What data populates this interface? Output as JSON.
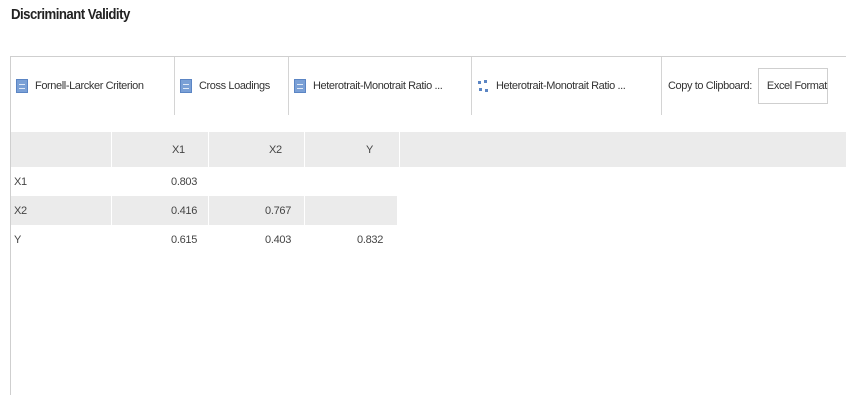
{
  "page": {
    "title": "Discriminant Validity"
  },
  "tabs": [
    {
      "label": "Fornell-Larcker Criterion",
      "icon": "table-icon"
    },
    {
      "label": "Cross Loadings",
      "icon": "table-icon"
    },
    {
      "label": "Heterotrait-Monotrait Ratio ...",
      "icon": "table-icon"
    },
    {
      "label": "Heterotrait-Monotrait Ratio ...",
      "icon": "graph-icon"
    }
  ],
  "clipboard": {
    "label": "Copy to Clipboard:",
    "format": "Excel Format"
  },
  "table": {
    "columns": [
      "X1",
      "X2",
      "Y"
    ],
    "rows": [
      {
        "label": "X1",
        "values": [
          "0.803",
          "",
          ""
        ]
      },
      {
        "label": "X2",
        "values": [
          "0.416",
          "0.767",
          ""
        ]
      },
      {
        "label": "Y",
        "values": [
          "0.615",
          "0.403",
          "0.832"
        ]
      }
    ]
  }
}
